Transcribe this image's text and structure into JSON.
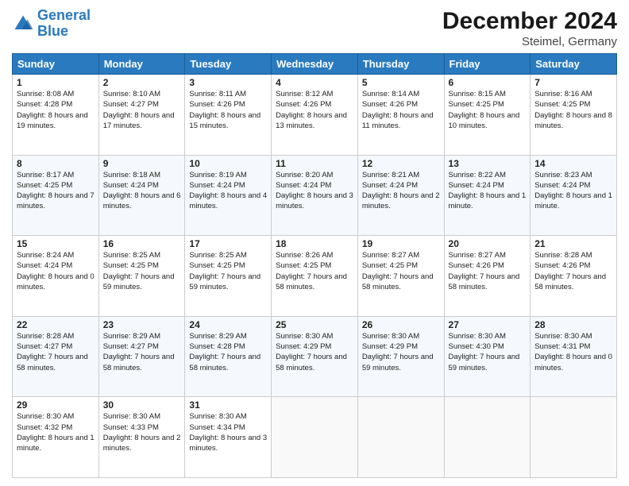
{
  "logo": {
    "line1": "General",
    "line2": "Blue"
  },
  "title": "December 2024",
  "subtitle": "Steimel, Germany",
  "days_header": [
    "Sunday",
    "Monday",
    "Tuesday",
    "Wednesday",
    "Thursday",
    "Friday",
    "Saturday"
  ],
  "weeks": [
    [
      {
        "day": "1",
        "sunrise": "8:08 AM",
        "sunset": "4:28 PM",
        "daylight": "8 hours and 19 minutes."
      },
      {
        "day": "2",
        "sunrise": "8:10 AM",
        "sunset": "4:27 PM",
        "daylight": "8 hours and 17 minutes."
      },
      {
        "day": "3",
        "sunrise": "8:11 AM",
        "sunset": "4:26 PM",
        "daylight": "8 hours and 15 minutes."
      },
      {
        "day": "4",
        "sunrise": "8:12 AM",
        "sunset": "4:26 PM",
        "daylight": "8 hours and 13 minutes."
      },
      {
        "day": "5",
        "sunrise": "8:14 AM",
        "sunset": "4:26 PM",
        "daylight": "8 hours and 11 minutes."
      },
      {
        "day": "6",
        "sunrise": "8:15 AM",
        "sunset": "4:25 PM",
        "daylight": "8 hours and 10 minutes."
      },
      {
        "day": "7",
        "sunrise": "8:16 AM",
        "sunset": "4:25 PM",
        "daylight": "8 hours and 8 minutes."
      }
    ],
    [
      {
        "day": "8",
        "sunrise": "8:17 AM",
        "sunset": "4:25 PM",
        "daylight": "8 hours and 7 minutes."
      },
      {
        "day": "9",
        "sunrise": "8:18 AM",
        "sunset": "4:24 PM",
        "daylight": "8 hours and 6 minutes."
      },
      {
        "day": "10",
        "sunrise": "8:19 AM",
        "sunset": "4:24 PM",
        "daylight": "8 hours and 4 minutes."
      },
      {
        "day": "11",
        "sunrise": "8:20 AM",
        "sunset": "4:24 PM",
        "daylight": "8 hours and 3 minutes."
      },
      {
        "day": "12",
        "sunrise": "8:21 AM",
        "sunset": "4:24 PM",
        "daylight": "8 hours and 2 minutes."
      },
      {
        "day": "13",
        "sunrise": "8:22 AM",
        "sunset": "4:24 PM",
        "daylight": "8 hours and 1 minute."
      },
      {
        "day": "14",
        "sunrise": "8:23 AM",
        "sunset": "4:24 PM",
        "daylight": "8 hours and 1 minute."
      }
    ],
    [
      {
        "day": "15",
        "sunrise": "8:24 AM",
        "sunset": "4:24 PM",
        "daylight": "8 hours and 0 minutes."
      },
      {
        "day": "16",
        "sunrise": "8:25 AM",
        "sunset": "4:25 PM",
        "daylight": "7 hours and 59 minutes."
      },
      {
        "day": "17",
        "sunrise": "8:25 AM",
        "sunset": "4:25 PM",
        "daylight": "7 hours and 59 minutes."
      },
      {
        "day": "18",
        "sunrise": "8:26 AM",
        "sunset": "4:25 PM",
        "daylight": "7 hours and 58 minutes."
      },
      {
        "day": "19",
        "sunrise": "8:27 AM",
        "sunset": "4:25 PM",
        "daylight": "7 hours and 58 minutes."
      },
      {
        "day": "20",
        "sunrise": "8:27 AM",
        "sunset": "4:26 PM",
        "daylight": "7 hours and 58 minutes."
      },
      {
        "day": "21",
        "sunrise": "8:28 AM",
        "sunset": "4:26 PM",
        "daylight": "7 hours and 58 minutes."
      }
    ],
    [
      {
        "day": "22",
        "sunrise": "8:28 AM",
        "sunset": "4:27 PM",
        "daylight": "7 hours and 58 minutes."
      },
      {
        "day": "23",
        "sunrise": "8:29 AM",
        "sunset": "4:27 PM",
        "daylight": "7 hours and 58 minutes."
      },
      {
        "day": "24",
        "sunrise": "8:29 AM",
        "sunset": "4:28 PM",
        "daylight": "7 hours and 58 minutes."
      },
      {
        "day": "25",
        "sunrise": "8:30 AM",
        "sunset": "4:29 PM",
        "daylight": "7 hours and 58 minutes."
      },
      {
        "day": "26",
        "sunrise": "8:30 AM",
        "sunset": "4:29 PM",
        "daylight": "7 hours and 59 minutes."
      },
      {
        "day": "27",
        "sunrise": "8:30 AM",
        "sunset": "4:30 PM",
        "daylight": "7 hours and 59 minutes."
      },
      {
        "day": "28",
        "sunrise": "8:30 AM",
        "sunset": "4:31 PM",
        "daylight": "8 hours and 0 minutes."
      }
    ],
    [
      {
        "day": "29",
        "sunrise": "8:30 AM",
        "sunset": "4:32 PM",
        "daylight": "8 hours and 1 minute."
      },
      {
        "day": "30",
        "sunrise": "8:30 AM",
        "sunset": "4:33 PM",
        "daylight": "8 hours and 2 minutes."
      },
      {
        "day": "31",
        "sunrise": "8:30 AM",
        "sunset": "4:34 PM",
        "daylight": "8 hours and 3 minutes."
      },
      null,
      null,
      null,
      null
    ]
  ]
}
